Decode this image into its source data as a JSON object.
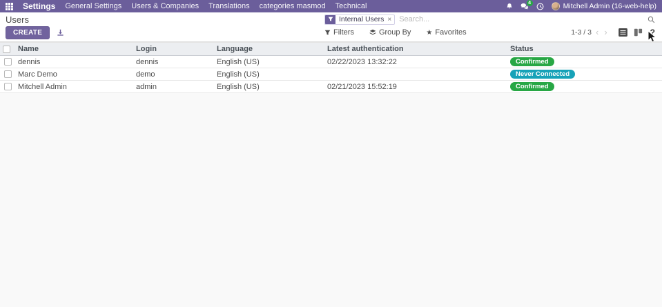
{
  "navbar": {
    "app_name": "Settings",
    "menu_items": [
      "General Settings",
      "Users & Companies",
      "Translations",
      "categories masmod",
      "Technical"
    ],
    "message_badge_count": "4",
    "user_name": "Mitchell Admin (16-web-help)",
    "colors": {
      "navbar_bg": "#6b5e9b",
      "message_badge": "#28a745"
    }
  },
  "control_panel": {
    "breadcrumb_title": "Users",
    "create_label": "CREATE",
    "search": {
      "facet_label": "Internal Users",
      "facet_remove": "×",
      "placeholder": "Search..."
    },
    "filters_label": "Filters",
    "group_by_label": "Group By",
    "favorites_label": "Favorites",
    "favorites_star": "★",
    "pager": {
      "text": "1-3 / 3",
      "prev": "‹",
      "next": "›"
    },
    "help_label": "?"
  },
  "table": {
    "headers": {
      "name": "Name",
      "login": "Login",
      "language": "Language",
      "latest_auth": "Latest authentication",
      "status": "Status"
    },
    "rows": [
      {
        "name": "dennis",
        "login": "dennis",
        "language": "English (US)",
        "latest_auth": "02/22/2023 13:32:22",
        "status": "Confirmed"
      },
      {
        "name": "Marc Demo",
        "login": "demo",
        "language": "English (US)",
        "latest_auth": "",
        "status": "Never Connected"
      },
      {
        "name": "Mitchell Admin",
        "login": "admin",
        "language": "English (US)",
        "latest_auth": "02/21/2023 15:52:19",
        "status": "Confirmed"
      }
    ],
    "status_colors": {
      "confirmed": "#28a745",
      "never_connected": "#17a2b8"
    }
  }
}
